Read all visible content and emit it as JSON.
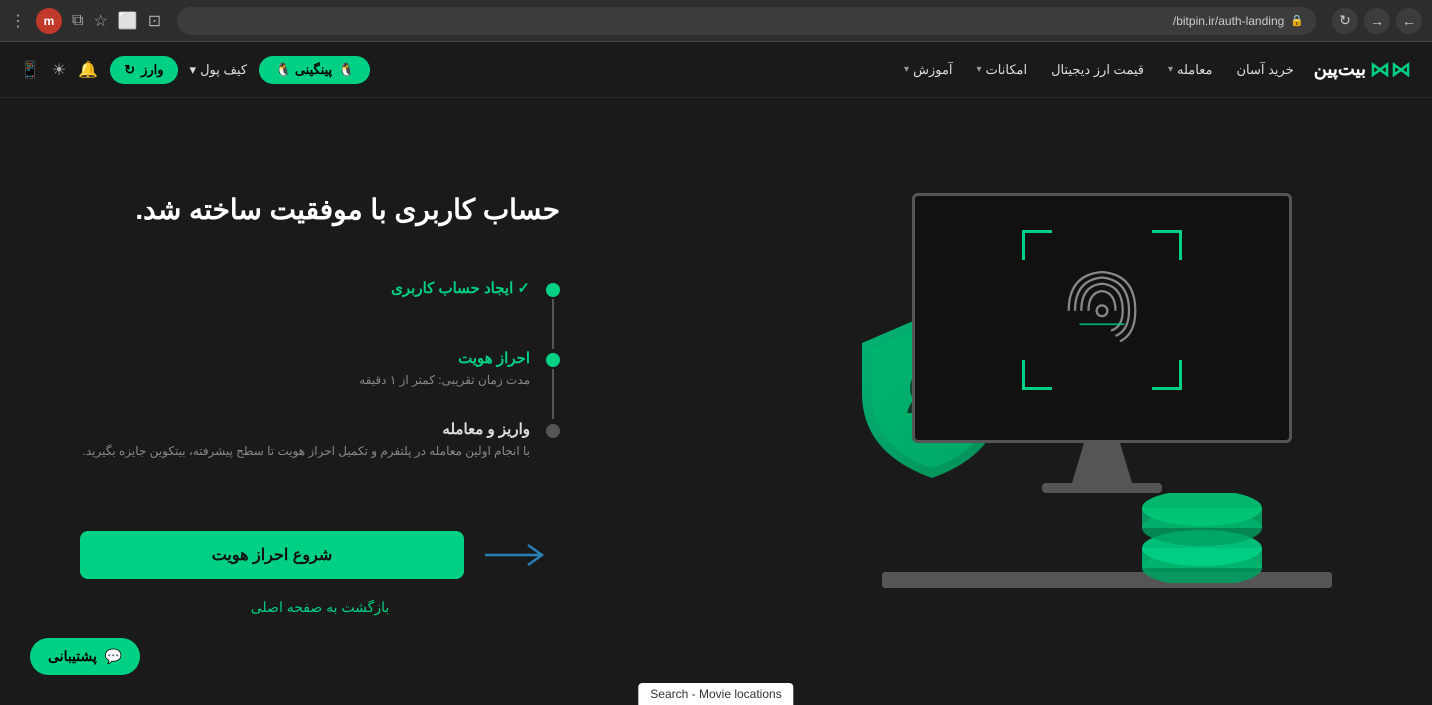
{
  "browser": {
    "url": "bitpin.ir/auth-landing/",
    "back_title": "back",
    "forward_title": "forward",
    "reload_title": "reload",
    "user_initial": "m"
  },
  "navbar": {
    "logo_text": "بیت‌پین",
    "logo_symbol": "XX",
    "links": [
      {
        "label": "خرید آسان",
        "has_arrow": false
      },
      {
        "label": "معامله",
        "has_arrow": true
      },
      {
        "label": "قیمت ارز دیجیتال",
        "has_arrow": false
      },
      {
        "label": "امکانات",
        "has_arrow": true
      },
      {
        "label": "آموزش",
        "has_arrow": true
      }
    ],
    "pinghini_label": "پینگینی 🐧",
    "kif_pol_label": "کیف پول",
    "varize_label": "وارز"
  },
  "main": {
    "title": "حساب کاربری با موفقیت ساخته شد.",
    "steps": [
      {
        "id": "step1",
        "title": "ایجاد حساب کاربری",
        "subtitle": "",
        "status": "active"
      },
      {
        "id": "step2",
        "title": "احراز هویت",
        "subtitle": "مدت زمان تقریبی: کمتر از ۱ دقیقه",
        "status": "active"
      },
      {
        "id": "step3",
        "title": "واریز و معامله",
        "subtitle": "با انجام اولین معامله در پلتفرم و تکمیل احراز هویت تا سطح پیشرفته، بیتکوین جایزه بگیرید.",
        "status": "inactive"
      }
    ],
    "start_btn_label": "شروع احراز هویت",
    "back_link_label": "بازگشت به صفحه اصلی"
  },
  "support": {
    "label": "پشتیبانی"
  },
  "tooltip": {
    "text": "Search - Movie locations"
  },
  "colors": {
    "green": "#00d084",
    "dark_bg": "#1a1a1a",
    "accent_blue": "#2980b9"
  }
}
